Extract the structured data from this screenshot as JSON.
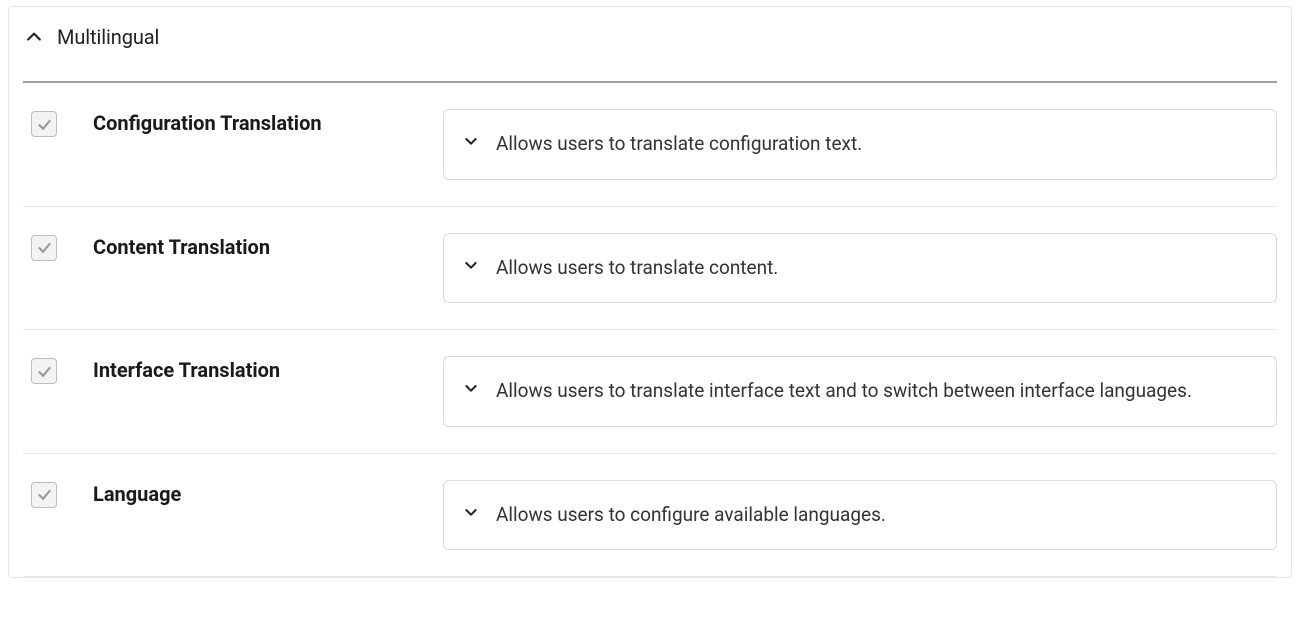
{
  "section": {
    "title": "Multilingual"
  },
  "modules": [
    {
      "name": "Configuration Translation",
      "description": "Allows users to translate configuration text.",
      "checked": true
    },
    {
      "name": "Content Translation",
      "description": "Allows users to translate content.",
      "checked": true
    },
    {
      "name": "Interface Translation",
      "description": "Allows users to translate interface text and to switch between interface languages.",
      "checked": true
    },
    {
      "name": "Language",
      "description": "Allows users to configure available languages.",
      "checked": true
    }
  ]
}
